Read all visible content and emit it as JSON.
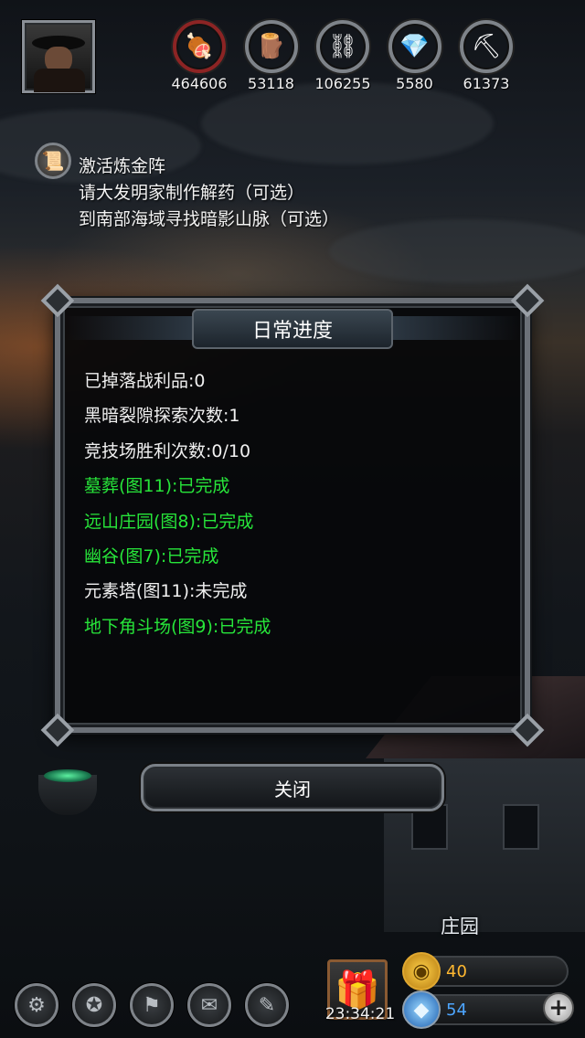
{
  "top": {
    "avatar": "character-portrait",
    "resources": [
      {
        "icon": "meat-icon",
        "glyph": "🍖",
        "value": "464606",
        "ring": "red"
      },
      {
        "icon": "wood-icon",
        "glyph": "🪵",
        "value": "53118",
        "ring": "grey"
      },
      {
        "icon": "iron-icon",
        "glyph": "⛓",
        "value": "106255",
        "ring": "grey"
      },
      {
        "icon": "crystal-icon",
        "glyph": "💎",
        "value": "5580",
        "ring": "grey"
      },
      {
        "icon": "ore-icon",
        "glyph": "⛏",
        "value": "61373",
        "ring": "grey"
      }
    ]
  },
  "quests": {
    "icon": "scroll-icon",
    "items": [
      "激活炼金阵",
      "请大发明家制作解药（可选）",
      "到南部海域寻找暗影山脉（可选）"
    ]
  },
  "dialog": {
    "title": "日常进度",
    "rows": [
      {
        "text": "已掉落战利品:0",
        "status": "todo"
      },
      {
        "text": "黑暗裂隙探索次数:1",
        "status": "todo"
      },
      {
        "text": "竞技场胜利次数:0/10",
        "status": "todo"
      },
      {
        "text": "墓葬(图11):已完成",
        "status": "done"
      },
      {
        "text": "远山庄园(图8):已完成",
        "status": "done"
      },
      {
        "text": "幽谷(图7):已完成",
        "status": "done"
      },
      {
        "text": "元素塔(图11):未完成",
        "status": "todo"
      },
      {
        "text": "地下角斗场(图9):已完成",
        "status": "done"
      }
    ],
    "close_label": "关闭"
  },
  "bottom": {
    "location": "庄园",
    "clock": "23:34:21",
    "gold": "40",
    "gems": "54",
    "toolbar": [
      {
        "icon": "gear-icon",
        "glyph": "⚙"
      },
      {
        "icon": "star-badge-icon",
        "glyph": "✪"
      },
      {
        "icon": "banner-icon",
        "glyph": "⚑"
      },
      {
        "icon": "mail-icon",
        "glyph": "✉"
      },
      {
        "icon": "scroll-icon",
        "glyph": "✎"
      }
    ]
  },
  "colors": {
    "done": "#27e53a",
    "todo": "#f0f0f0",
    "gold": "#ffb830",
    "gem": "#4da6ff"
  }
}
